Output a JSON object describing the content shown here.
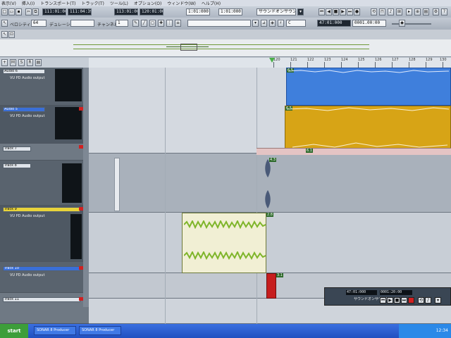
{
  "menubar": {
    "items": [
      "表示(V)",
      "挿入(I)",
      "トランスポート(T)",
      "トラック(T)",
      "ツール(L)",
      "オプション(O)",
      "ウィンドウ(W)",
      "ヘルプ(H)"
    ]
  },
  "toolbar1": {
    "time_a": "111:01:000",
    "time_b": "111:04:398",
    "time_c": "113:01:000",
    "time_d": "120:01:000",
    "time_e": "1:01:000",
    "time_f": "1:01:000",
    "sound_mode": "サウンドオンサウンド"
  },
  "toolbar2": {
    "velocity_label": "ベロシティ",
    "velocity_value": "64",
    "duration_label": "デュレーション",
    "channel_label": "チャンネル",
    "channel_value": "1",
    "key_value": "C",
    "pos_a": "47:01:000",
    "pos_b": "0001.00:00"
  },
  "ruler": {
    "labels": [
      "120",
      "121",
      "122",
      "123",
      "124",
      "125",
      "126",
      "127",
      "128",
      "129",
      "130"
    ]
  },
  "tracks": [
    {
      "name": "Audio 6",
      "input": "VU PD Audio output"
    },
    {
      "name": "Audio 5",
      "input": "VU PD Audio output"
    },
    {
      "name": "Track 7",
      "input": ""
    },
    {
      "name": "Track 8",
      "input": ""
    },
    {
      "name": "Track 9",
      "input": "VU PD Audio output"
    },
    {
      "name": "Track 10",
      "input": "VU PD Audio output"
    },
    {
      "name": "Track 11",
      "input": ""
    }
  ],
  "clips": {
    "blue_tag": "6.5",
    "yellow_tag": "6.5",
    "green_tag": "2.8",
    "red_tag": "3.1",
    "pink_tag": "6.1"
  },
  "transport": {
    "time": "47:01:000",
    "sub": "0001:20:00",
    "label": "サウンドオンサウンド"
  },
  "taskbar": {
    "start": "start",
    "tasks": [
      "SONAR 8 Producer",
      "SONAR 8 Producer"
    ],
    "clock": "12:34"
  },
  "colors": {
    "blue_clip": "#3f7fdc",
    "yellow_clip": "#d7a416",
    "green_wave": "#7fb52a",
    "red_clip": "#c61e1e"
  }
}
